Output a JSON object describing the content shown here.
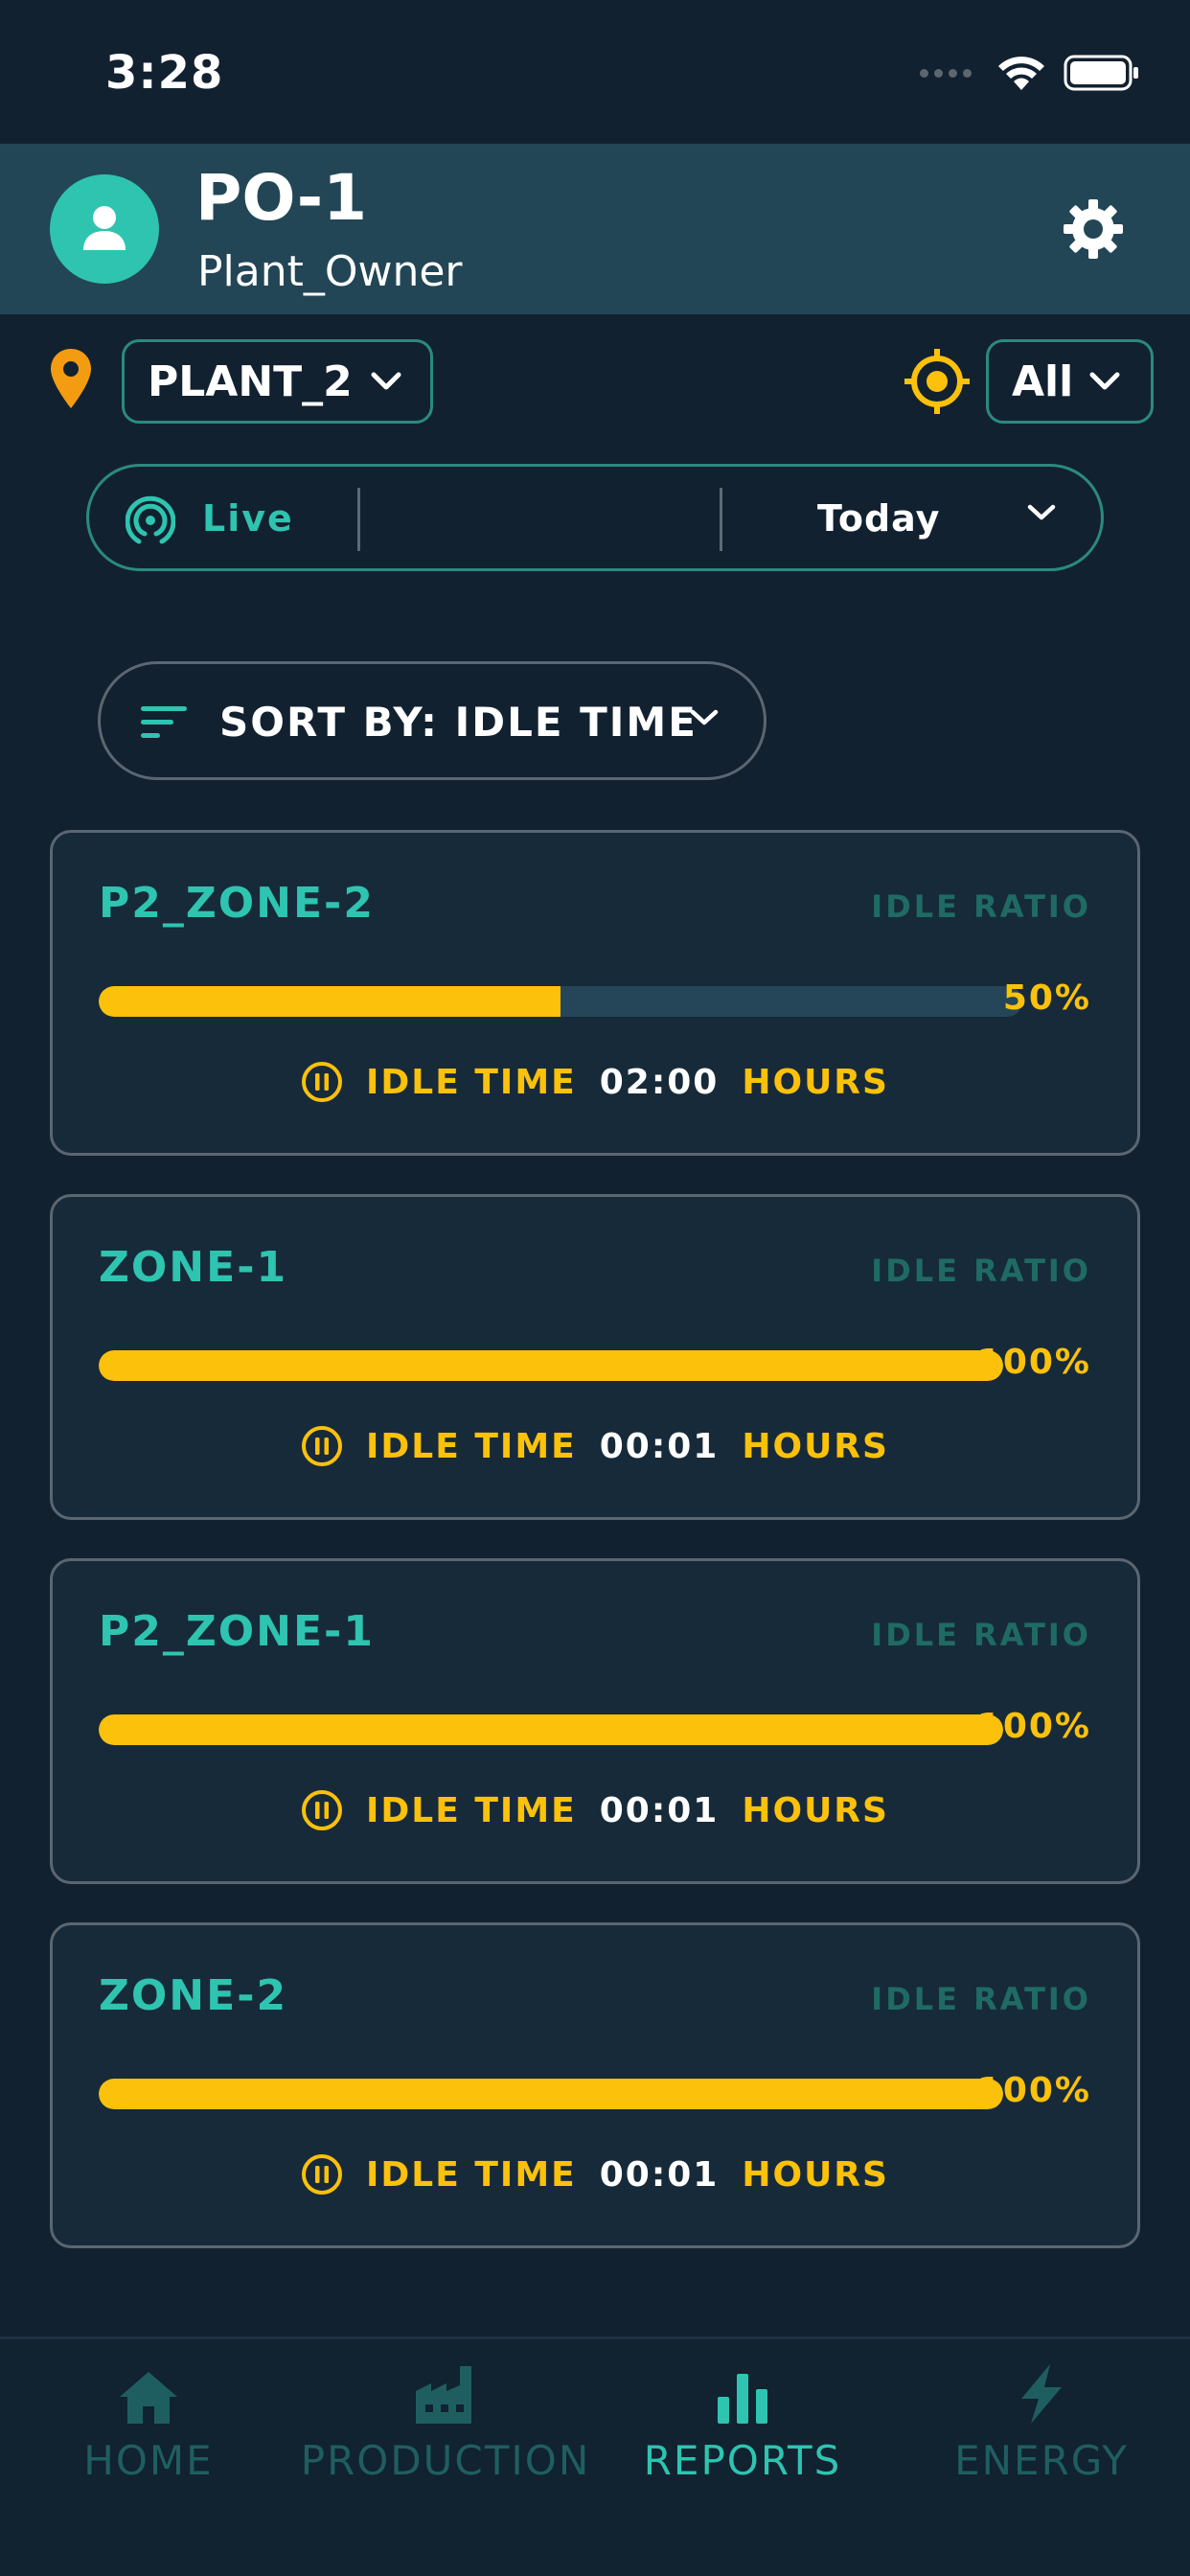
{
  "status_bar": {
    "time": "3:28"
  },
  "header": {
    "title": "PO-1",
    "subtitle": "Plant_Owner"
  },
  "filters": {
    "plant": "PLANT_2",
    "scope": "All"
  },
  "time_filter": {
    "live_label": "Live",
    "period": "Today"
  },
  "sort": {
    "label": "SORT BY: IDLE TIME"
  },
  "cards": [
    {
      "name": "P2_ZONE-2",
      "ratio_label": "IDLE RATIO",
      "ratio": 0.5,
      "percent": "50%",
      "idle_label": "IDLE TIME",
      "idle_value": "02:00",
      "idle_unit": "HOURS"
    },
    {
      "name": "ZONE-1",
      "ratio_label": "IDLE RATIO",
      "ratio": 1.0,
      "percent": "100%",
      "idle_label": "IDLE TIME",
      "idle_value": "00:01",
      "idle_unit": "HOURS"
    },
    {
      "name": "P2_ZONE-1",
      "ratio_label": "IDLE RATIO",
      "ratio": 1.0,
      "percent": "100%",
      "idle_label": "IDLE TIME",
      "idle_value": "00:01",
      "idle_unit": "HOURS"
    },
    {
      "name": "ZONE-2",
      "ratio_label": "IDLE RATIO",
      "ratio": 1.0,
      "percent": "100%",
      "idle_label": "IDLE TIME",
      "idle_value": "00:01",
      "idle_unit": "HOURS"
    }
  ],
  "nav": [
    {
      "label": "HOME",
      "icon": "home-icon",
      "active": false
    },
    {
      "label": "PRODUCTION",
      "icon": "factory-icon",
      "active": false
    },
    {
      "label": "REPORTS",
      "icon": "bar-chart-icon",
      "active": true
    },
    {
      "label": "ENERGY",
      "icon": "lightning-icon",
      "active": false
    }
  ],
  "colors": {
    "accent": "#2ec4b0",
    "warning": "#fbc10b",
    "background": "#122130",
    "header": "#224655",
    "location_pin": "#f39c12"
  }
}
